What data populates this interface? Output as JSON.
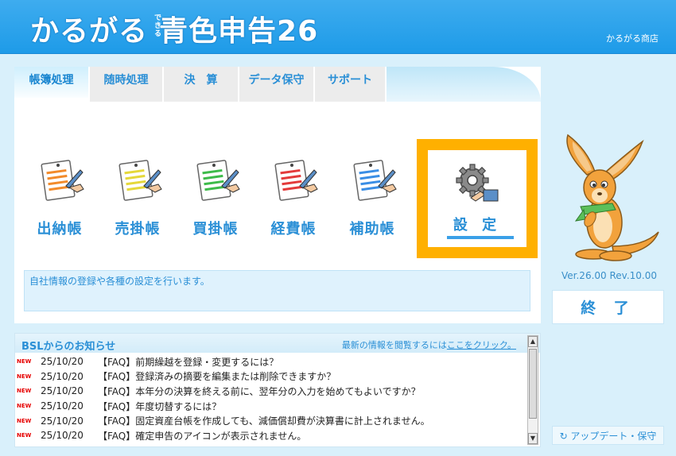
{
  "header": {
    "logo": "かるがる青色申告26",
    "logo_main": "かるがる",
    "logo_sub": "できる",
    "logo_rest": "青色申告26",
    "company": "かるがる商店"
  },
  "tabs": [
    {
      "label": "帳簿処理",
      "active": true
    },
    {
      "label": "随時処理",
      "active": false
    },
    {
      "label": "決　算",
      "active": false
    },
    {
      "label": "データ保守",
      "active": false
    },
    {
      "label": "サポート",
      "active": false
    }
  ],
  "ledgers": [
    {
      "label": "出納帳",
      "color": "#f28b2b"
    },
    {
      "label": "売掛帳",
      "color": "#e5d83a"
    },
    {
      "label": "買掛帳",
      "color": "#3dbb4a"
    },
    {
      "label": "経費帳",
      "color": "#e33b3b"
    },
    {
      "label": "補助帳",
      "color": "#3a8ee5"
    }
  ],
  "settings": {
    "label": "設 定",
    "icon": "gear-icon"
  },
  "description": "自社情報の登録や各種の設定を行います。",
  "version": "Ver.26.00 Rev.10.00",
  "exit_label": "終 了",
  "update_label": "↻ アップデート・保守",
  "news": {
    "title": "BSLからのお知らせ",
    "more_prefix": "最新の情報を閲覧するには",
    "more_link": "ここをクリック。",
    "items": [
      {
        "badge": "NEW",
        "date": "25/10/20",
        "text": "【FAQ】前期繰越を登録・変更するには？"
      },
      {
        "badge": "NEW",
        "date": "25/10/20",
        "text": "【FAQ】登録済みの摘要を編集または削除できますか？"
      },
      {
        "badge": "NEW",
        "date": "25/10/20",
        "text": "【FAQ】本年分の決算を終える前に、翌年分の入力を始めてもよいですか？"
      },
      {
        "badge": "NEW",
        "date": "25/10/20",
        "text": "【FAQ】年度切替するには？"
      },
      {
        "badge": "NEW",
        "date": "25/10/20",
        "text": "【FAQ】固定資産台帳を作成しても、減価償却費が決算書に計上されません。"
      },
      {
        "badge": "NEW",
        "date": "25/10/20",
        "text": "【FAQ】確定申告のアイコンが表示されません。"
      }
    ]
  },
  "colors": {
    "accent": "#2a8fd6",
    "highlight": "#ffb000",
    "header": "#2aa3ee"
  }
}
